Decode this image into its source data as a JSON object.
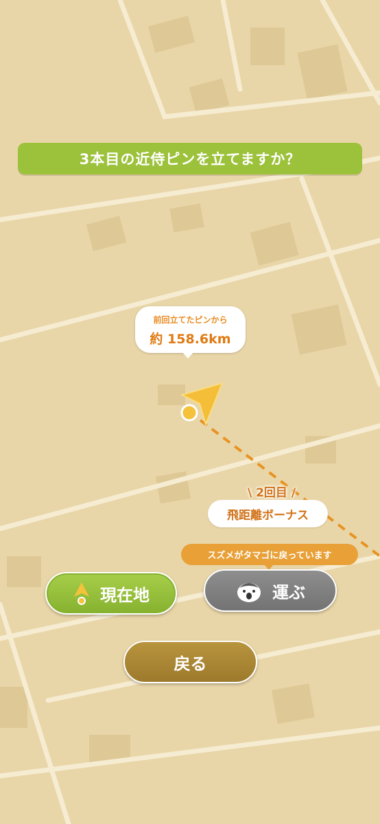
{
  "prompt": {
    "question": "3本目の近侍ピンを立てますか？"
  },
  "distance_bubble": {
    "caption": "前回立てたピンから",
    "distance": "約 158.6km"
  },
  "bonus": {
    "count_label": "\\ 2回目 /",
    "title": "飛距離ボーナス"
  },
  "status_tip": {
    "text": "スズメがタマゴに戻っています"
  },
  "buttons": {
    "current_location": "現在地",
    "carry": "運ぶ",
    "back": "戻る"
  },
  "colors": {
    "map_bg": "#e9d6a8",
    "accent_green": "#9cc13a",
    "accent_orange": "#e78d24",
    "button_gray": "#808080",
    "button_gold": "#ac8835"
  },
  "icons": {
    "current_location": "location-arrow-icon",
    "carry": "sparrow-icon",
    "pin": "location-pin-icon"
  }
}
